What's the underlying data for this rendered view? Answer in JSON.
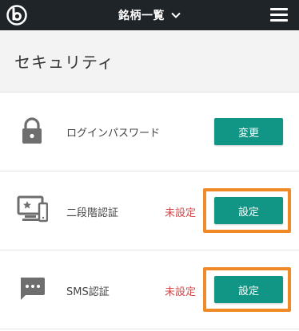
{
  "header": {
    "title": "銘柄一覧",
    "logo_icon": "b-logo-icon",
    "menu_icon": "hamburger-icon",
    "background": "#1f2429"
  },
  "page": {
    "section_title": "セキュリティ"
  },
  "rows": [
    {
      "label": "ログインパスワード",
      "status": "",
      "button": "変更",
      "icon": "lock-icon",
      "highlighted": false
    },
    {
      "label": "二段階認証",
      "status": "未設定",
      "button": "設定",
      "icon": "monitor-star-icon",
      "highlighted": true
    },
    {
      "label": "SMS認証",
      "status": "未設定",
      "button": "設定",
      "icon": "chat-bubble-icon",
      "highlighted": true
    }
  ],
  "colors": {
    "accent": "#119585",
    "status": "#d14b4b",
    "highlight": "#f08a27"
  }
}
